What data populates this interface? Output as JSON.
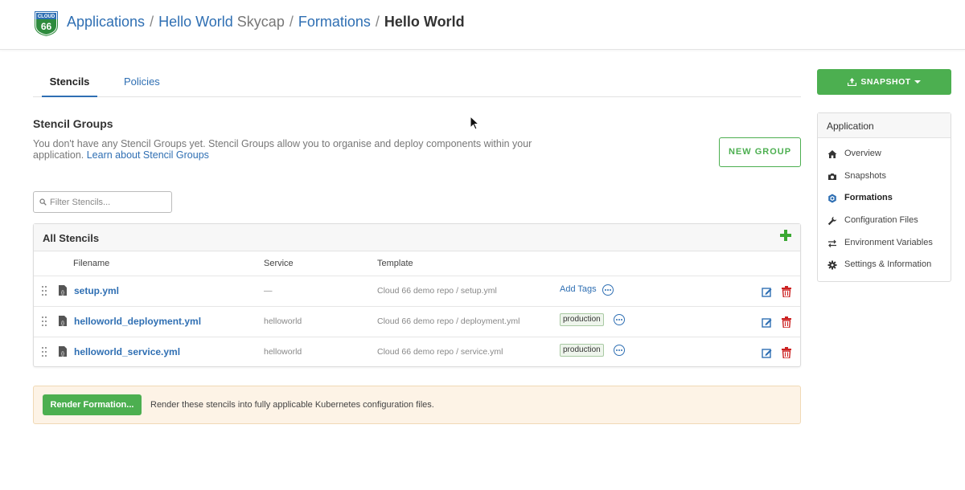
{
  "header": {
    "logo_top": "CLOUD",
    "logo_bottom": "66",
    "breadcrumb": {
      "applications": "Applications",
      "sep1": "/",
      "app_name": "Hello World",
      "app_suffix": "Skycap",
      "sep2": "/",
      "formations": "Formations",
      "sep3": "/",
      "current": "Hello World"
    }
  },
  "tabs": [
    {
      "label": "Stencils",
      "active": true
    },
    {
      "label": "Policies",
      "active": false
    }
  ],
  "stencil_groups": {
    "title": "Stencil Groups",
    "description": "You don't have any Stencil Groups yet. Stencil Groups allow you to organise and deploy components within your application.",
    "learn_link": "Learn about Stencil Groups",
    "new_group_label": "NEW GROUP"
  },
  "filter": {
    "placeholder": "Filter Stencils...",
    "value": ""
  },
  "stencils": {
    "title": "All Stencils",
    "columns": {
      "filename": "Filename",
      "service": "Service",
      "template": "Template"
    },
    "rows": [
      {
        "filename": "setup.yml",
        "service": "—",
        "template": "Cloud 66 demo repo / setup.yml",
        "tag": "",
        "add_tags": "Add Tags"
      },
      {
        "filename": "helloworld_deployment.yml",
        "service": "helloworld",
        "template": "Cloud 66 demo repo / deployment.yml",
        "tag": "production",
        "add_tags": ""
      },
      {
        "filename": "helloworld_service.yml",
        "service": "helloworld",
        "template": "Cloud 66 demo repo / service.yml",
        "tag": "production",
        "add_tags": ""
      }
    ]
  },
  "render": {
    "button_label": "Render Formation...",
    "text": "Render these stencils into fully applicable Kubernetes configuration files."
  },
  "snapshot": {
    "label": "SNAPSHOT"
  },
  "sidebar": {
    "title": "Application",
    "items": [
      {
        "label": "Overview",
        "icon": "home-icon",
        "active": false
      },
      {
        "label": "Snapshots",
        "icon": "camera-icon",
        "active": false
      },
      {
        "label": "Formations",
        "icon": "hexagon-icon",
        "active": true
      },
      {
        "label": "Configuration Files",
        "icon": "wrench-icon",
        "active": false
      },
      {
        "label": "Environment Variables",
        "icon": "swap-icon",
        "active": false
      },
      {
        "label": "Settings & Information",
        "icon": "gear-icon",
        "active": false
      }
    ]
  },
  "colors": {
    "accent": "#2f6fb3",
    "success": "#4caf50",
    "danger": "#cc2222",
    "warning_bg": "#fdf3e6"
  }
}
